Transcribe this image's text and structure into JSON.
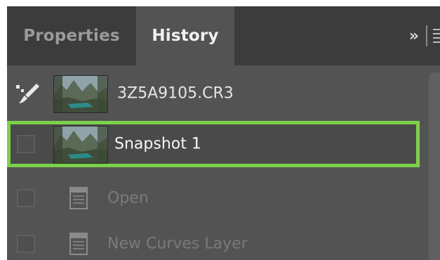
{
  "tabs": {
    "properties_label": "Properties",
    "history_label": "History"
  },
  "controls": {
    "collapse_glyph": "»",
    "menu_icon": "panel-menu-icon"
  },
  "history": {
    "items": [
      {
        "label": "3Z5A9105.CR3",
        "type": "source",
        "icon": "history-brush-icon"
      },
      {
        "label": "Snapshot 1",
        "type": "snapshot",
        "selected": true
      },
      {
        "label": "Open",
        "type": "state",
        "icon": "document-icon"
      },
      {
        "label": "New Curves Layer",
        "type": "state",
        "icon": "document-icon"
      }
    ]
  },
  "colors": {
    "panel_bg": "#535353",
    "tabbar_bg": "#3c3c3c",
    "selection_border": "#7cd14a",
    "active_text": "#f0f0f0",
    "dim_text": "#7a7a7a"
  }
}
